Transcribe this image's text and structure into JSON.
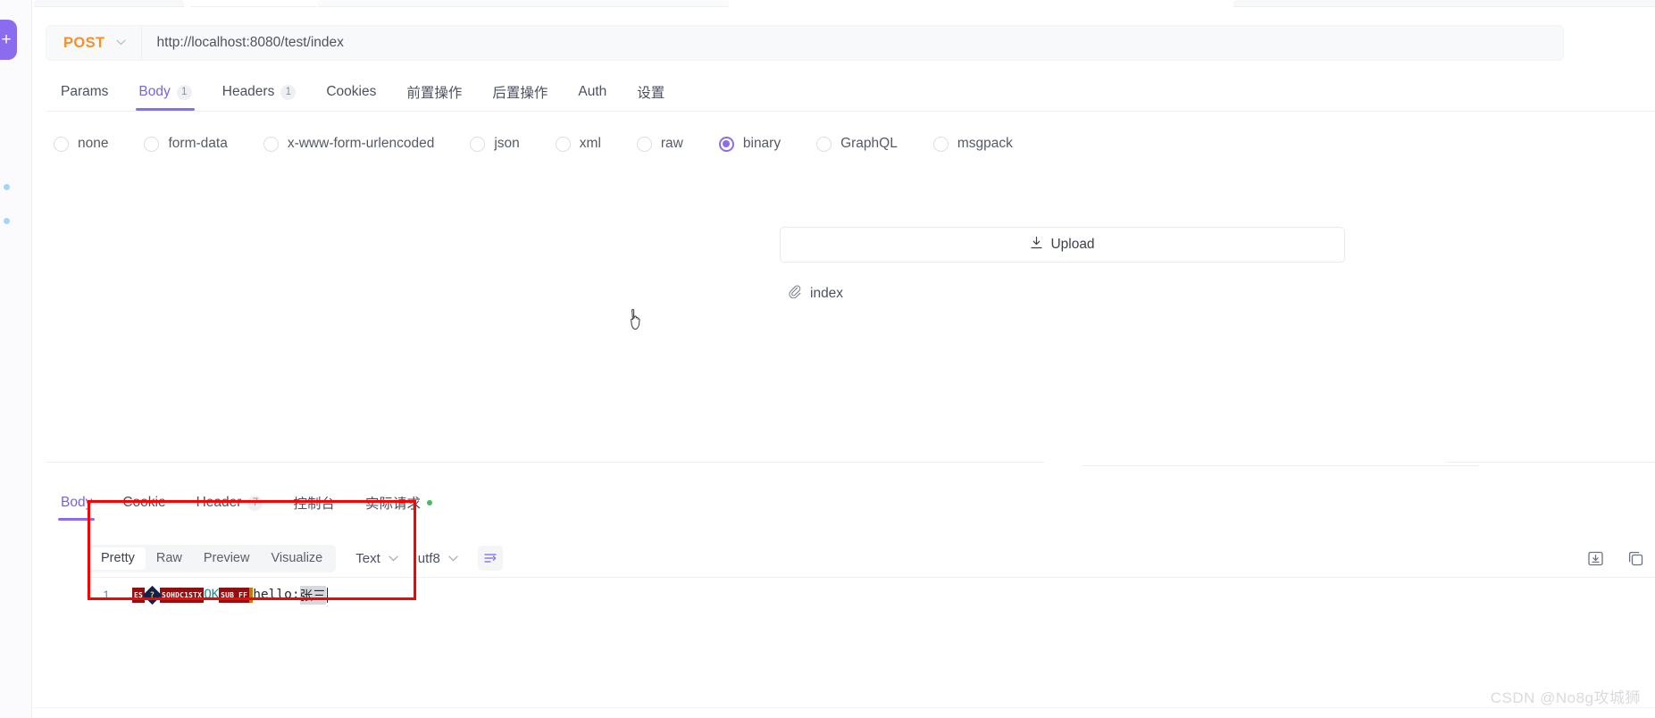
{
  "sidebar": {
    "add_button_label": "+",
    "dot_one": "",
    "dot_two": ""
  },
  "request": {
    "method": "POST",
    "url": "http://localhost:8080/test/index",
    "tabs": [
      {
        "label": "Params",
        "count": "",
        "active": false
      },
      {
        "label": "Body",
        "count": "1",
        "active": true
      },
      {
        "label": "Headers",
        "count": "1",
        "active": false
      },
      {
        "label": "Cookies",
        "count": "",
        "active": false
      },
      {
        "label": "前置操作",
        "count": "",
        "active": false
      },
      {
        "label": "后置操作",
        "count": "",
        "active": false
      },
      {
        "label": "Auth",
        "count": "",
        "active": false
      },
      {
        "label": "设置",
        "count": "",
        "active": false
      }
    ],
    "body_types": [
      {
        "label": "none",
        "selected": false
      },
      {
        "label": "form-data",
        "selected": false
      },
      {
        "label": "x-www-form-urlencoded",
        "selected": false
      },
      {
        "label": "json",
        "selected": false
      },
      {
        "label": "xml",
        "selected": false
      },
      {
        "label": "raw",
        "selected": false
      },
      {
        "label": "binary",
        "selected": true
      },
      {
        "label": "GraphQL",
        "selected": false
      },
      {
        "label": "msgpack",
        "selected": false
      }
    ],
    "upload": {
      "button_label": "Upload",
      "icon": "upload-icon",
      "attached_file": "index",
      "attachment_icon": "paperclip-icon"
    }
  },
  "response": {
    "tabs": [
      {
        "label": "Body",
        "count": "",
        "active": true,
        "dot": false
      },
      {
        "label": "Cookie",
        "count": "",
        "active": false,
        "dot": false
      },
      {
        "label": "Header",
        "count": "7",
        "active": false,
        "dot": false
      },
      {
        "label": "控制台",
        "count": "",
        "active": false,
        "dot": false
      },
      {
        "label": "实际请求",
        "count": "",
        "active": false,
        "dot": true
      }
    ],
    "view_modes": [
      {
        "label": "Pretty",
        "active": true
      },
      {
        "label": "Raw",
        "active": false
      },
      {
        "label": "Preview",
        "active": false
      },
      {
        "label": "Visualize",
        "active": false
      }
    ],
    "format_select": "Text",
    "charset_select": "utf8",
    "wrap_icon": "text-wrap-icon",
    "actions": [
      {
        "icon": "download-icon"
      },
      {
        "icon": "copy-icon"
      }
    ],
    "body": {
      "line_number": "1",
      "tokens": [
        {
          "type": "control",
          "text": "ES"
        },
        {
          "type": "replacement",
          "text": "?"
        },
        {
          "type": "control",
          "text": "SOHDC1STX"
        },
        {
          "type": "ok",
          "text": "OK"
        },
        {
          "type": "control-ff",
          "text": "SUB FF"
        },
        {
          "type": "plain",
          "text": "hello:"
        },
        {
          "type": "selected",
          "text": "张三"
        }
      ],
      "plain_text": "hello:张三"
    }
  },
  "watermark": "CSDN @No8g攻城狮",
  "colors": {
    "accent": "#8b6cef",
    "method": "#f5902b",
    "control_char": "#8f1010",
    "ok_token": "#2e8f8f",
    "annotation": "#ff0000",
    "status_dot": "#3fbf5f"
  }
}
